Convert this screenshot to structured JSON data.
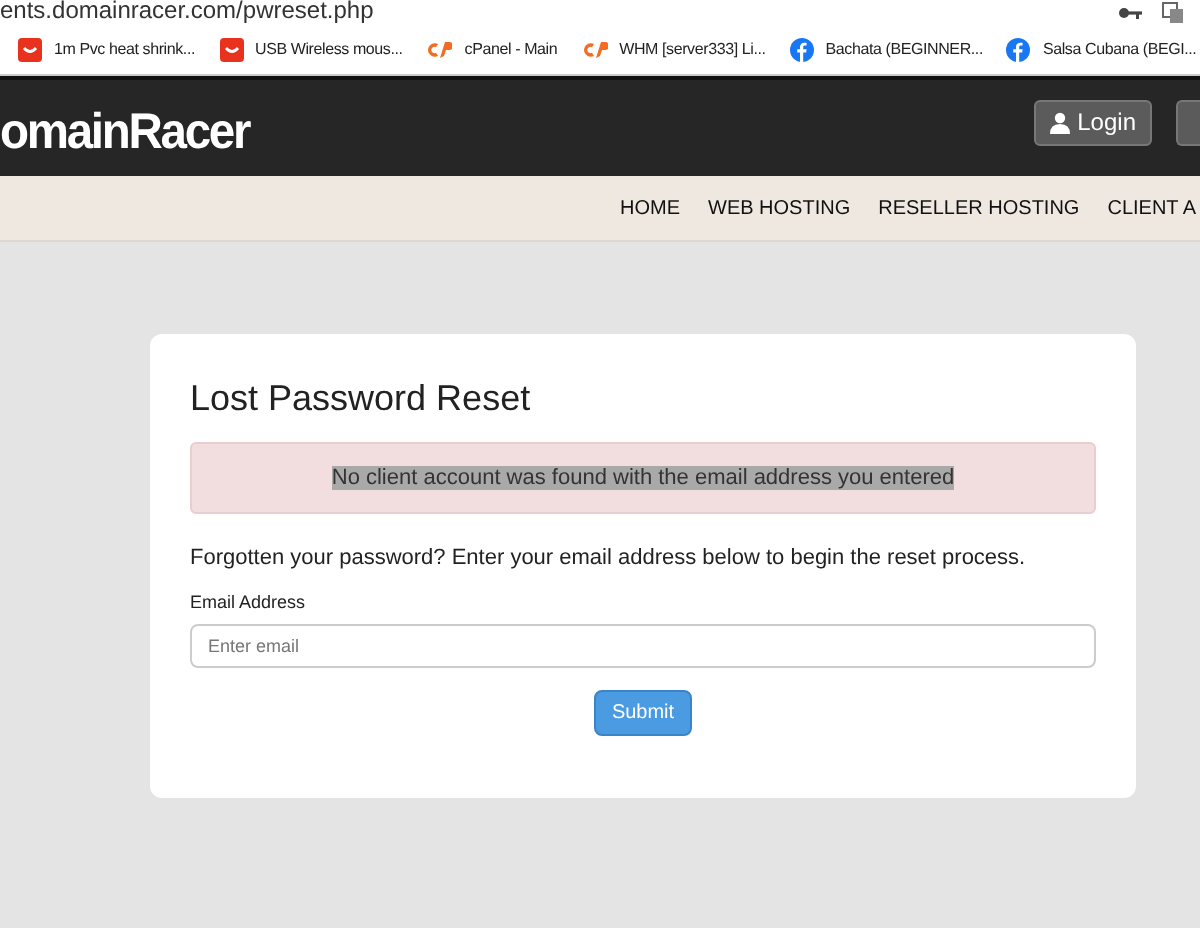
{
  "browser": {
    "url": "ents.domainracer.com/pwreset.php",
    "bookmarks": [
      {
        "kind": "shop",
        "label": "1m Pvc heat shrink..."
      },
      {
        "kind": "shop",
        "label": "USB Wireless mous..."
      },
      {
        "kind": "cpanel",
        "label": "cPanel - Main"
      },
      {
        "kind": "cpanel",
        "label": "WHM [server333] Li..."
      },
      {
        "kind": "facebook",
        "label": "Bachata (BEGINNER..."
      },
      {
        "kind": "facebook",
        "label": "Salsa Cubana (BEGI..."
      }
    ]
  },
  "header": {
    "logo": "omainRacer",
    "login_button": "Login"
  },
  "nav": {
    "items": [
      "HOME",
      "WEB HOSTING",
      "RESELLER HOSTING",
      "CLIENT A"
    ]
  },
  "card": {
    "title": "Lost Password Reset",
    "alert": {
      "text": "No client account was found with the email address you entered",
      "highlighted": true
    },
    "intro": "Forgotten your password? Enter your email address below to begin the reset process.",
    "field": {
      "label": "Email Address",
      "placeholder": "Enter email"
    },
    "submit": "Submit"
  }
}
